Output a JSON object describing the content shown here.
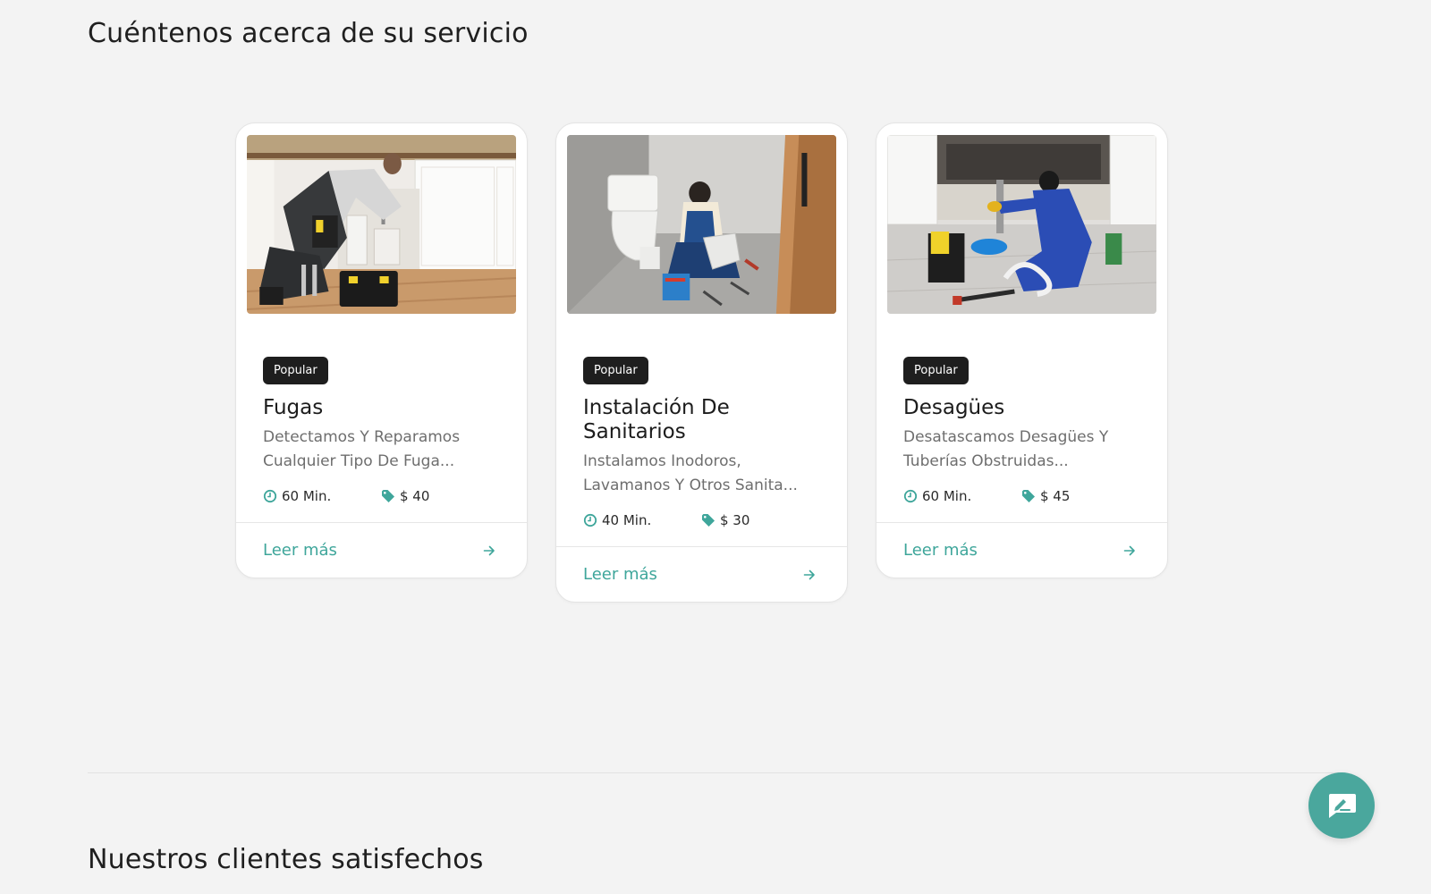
{
  "sections": {
    "services_title": "Cuéntenos acerca de su servicio",
    "clients_title": "Nuestros clientes satisfechos"
  },
  "cards": [
    {
      "badge": "Popular",
      "title": "Fugas",
      "description": "Detectamos Y Reparamos Cualquier Tipo De Fuga...",
      "duration": "60 Min.",
      "price": "$ 40",
      "link_label": "Leer más",
      "image_subject": "plumber kneeling at kitchen sink cabinet"
    },
    {
      "badge": "Popular",
      "title": "Instalación De Sanitarios",
      "description": "Instalamos Inodoros, Lavamanos Y Otros Sanita...",
      "duration": "40 Min.",
      "price": "$ 30",
      "link_label": "Leer más",
      "image_subject": "plumber installing toilet"
    },
    {
      "badge": "Popular",
      "title": "Desagües",
      "description": "Desatascamos Desagües Y Tuberías Obstruidas...",
      "duration": "60 Min.",
      "price": "$ 45",
      "link_label": "Leer más",
      "image_subject": "plumber in blue overalls fixing sink drain"
    }
  ],
  "icons": {
    "time": "clock-icon",
    "price": "price-tag-icon",
    "link": "arrow-right-icon",
    "fab": "feedback-chat-icon"
  },
  "colors": {
    "accent": "#3fa69b",
    "fab": "#4aa79d",
    "badge_bg": "#1e1e1e",
    "background": "#f3f3f3"
  }
}
